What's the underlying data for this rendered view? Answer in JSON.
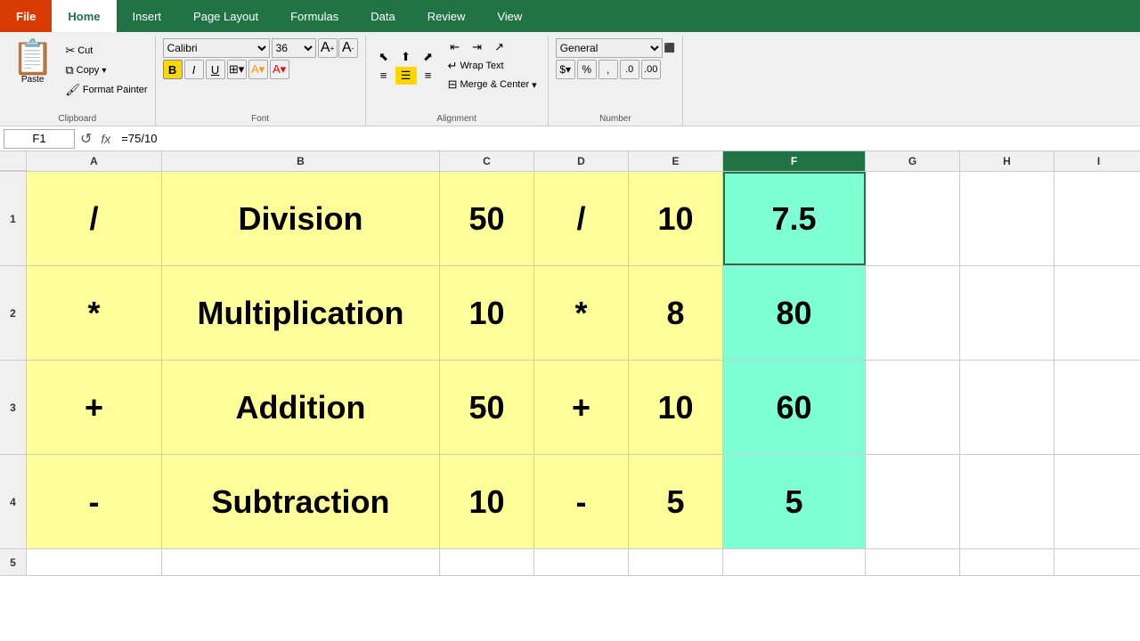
{
  "tabs": {
    "file": "File",
    "home": "Home",
    "insert": "Insert",
    "page_layout": "Page Layout",
    "formulas": "Formulas",
    "data": "Data",
    "review": "Review",
    "view": "View"
  },
  "ribbon": {
    "clipboard": {
      "label": "Clipboard",
      "paste": "Paste",
      "cut": "Cut",
      "copy": "Copy",
      "format_painter": "Format Painter"
    },
    "font": {
      "label": "Font",
      "font_name": "Calibri",
      "font_size": "36",
      "bold": "B",
      "italic": "I",
      "underline": "U",
      "borders": "⊞",
      "fill": "A",
      "font_color": "A"
    },
    "alignment": {
      "label": "Alignment",
      "wrap_text": "Wrap Text",
      "merge_center": "Merge & Center"
    },
    "number": {
      "label": "Number",
      "format": "General"
    }
  },
  "formula_bar": {
    "cell_ref": "F1",
    "formula": "=75/10"
  },
  "columns": [
    "A",
    "B",
    "C",
    "D",
    "E",
    "F",
    "G",
    "H",
    "I"
  ],
  "rows": [
    {
      "row_num": "1",
      "cells": [
        {
          "col": "A",
          "value": "/",
          "bg": "yellow"
        },
        {
          "col": "B",
          "value": "Division",
          "bg": "yellow"
        },
        {
          "col": "C",
          "value": "50",
          "bg": "yellow"
        },
        {
          "col": "D",
          "value": "/",
          "bg": "yellow"
        },
        {
          "col": "E",
          "value": "10",
          "bg": "yellow"
        },
        {
          "col": "F",
          "value": "7.5",
          "bg": "teal",
          "selected": true
        },
        {
          "col": "G",
          "value": "",
          "bg": "empty"
        },
        {
          "col": "H",
          "value": "",
          "bg": "empty"
        },
        {
          "col": "I",
          "value": "",
          "bg": "empty"
        }
      ]
    },
    {
      "row_num": "2",
      "cells": [
        {
          "col": "A",
          "value": "*",
          "bg": "yellow"
        },
        {
          "col": "B",
          "value": "Multiplication",
          "bg": "yellow"
        },
        {
          "col": "C",
          "value": "10",
          "bg": "yellow"
        },
        {
          "col": "D",
          "value": "*",
          "bg": "yellow"
        },
        {
          "col": "E",
          "value": "8",
          "bg": "yellow"
        },
        {
          "col": "F",
          "value": "80",
          "bg": "teal"
        },
        {
          "col": "G",
          "value": "",
          "bg": "empty"
        },
        {
          "col": "H",
          "value": "",
          "bg": "empty"
        },
        {
          "col": "I",
          "value": "",
          "bg": "empty"
        }
      ]
    },
    {
      "row_num": "3",
      "cells": [
        {
          "col": "A",
          "value": "+",
          "bg": "yellow"
        },
        {
          "col": "B",
          "value": "Addition",
          "bg": "yellow"
        },
        {
          "col": "C",
          "value": "50",
          "bg": "yellow"
        },
        {
          "col": "D",
          "value": "+",
          "bg": "yellow"
        },
        {
          "col": "E",
          "value": "10",
          "bg": "yellow"
        },
        {
          "col": "F",
          "value": "60",
          "bg": "teal"
        },
        {
          "col": "G",
          "value": "",
          "bg": "empty"
        },
        {
          "col": "H",
          "value": "",
          "bg": "empty"
        },
        {
          "col": "I",
          "value": "",
          "bg": "empty"
        }
      ]
    },
    {
      "row_num": "4",
      "cells": [
        {
          "col": "A",
          "value": "-",
          "bg": "yellow"
        },
        {
          "col": "B",
          "value": "Subtraction",
          "bg": "yellow"
        },
        {
          "col": "C",
          "value": "10",
          "bg": "yellow"
        },
        {
          "col": "D",
          "value": "-",
          "bg": "yellow"
        },
        {
          "col": "E",
          "value": "5",
          "bg": "yellow"
        },
        {
          "col": "F",
          "value": "5",
          "bg": "teal"
        },
        {
          "col": "G",
          "value": "",
          "bg": "empty"
        },
        {
          "col": "H",
          "value": "",
          "bg": "empty"
        },
        {
          "col": "I",
          "value": "",
          "bg": "empty"
        }
      ]
    },
    {
      "row_num": "5",
      "cells": [
        {
          "col": "A",
          "value": "",
          "bg": "empty"
        },
        {
          "col": "B",
          "value": "",
          "bg": "empty"
        },
        {
          "col": "C",
          "value": "",
          "bg": "empty"
        },
        {
          "col": "D",
          "value": "",
          "bg": "empty"
        },
        {
          "col": "E",
          "value": "",
          "bg": "empty"
        },
        {
          "col": "F",
          "value": "",
          "bg": "empty"
        },
        {
          "col": "G",
          "value": "",
          "bg": "empty"
        },
        {
          "col": "H",
          "value": "",
          "bg": "empty"
        },
        {
          "col": "I",
          "value": "",
          "bg": "empty"
        }
      ]
    }
  ]
}
